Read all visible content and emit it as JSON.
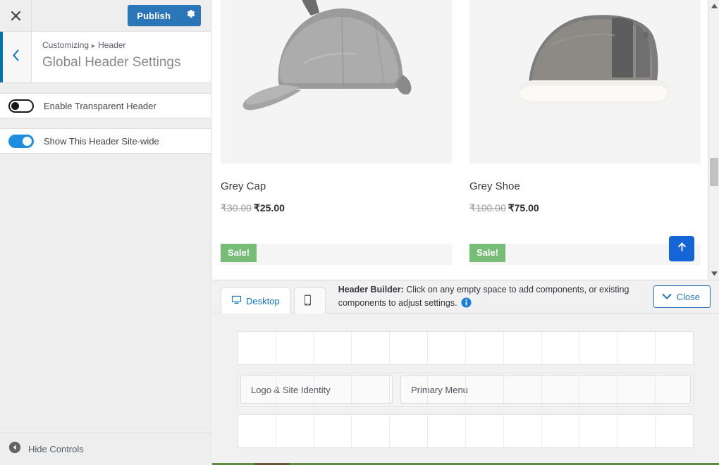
{
  "customizer": {
    "close_icon": "close-x-icon",
    "publish_label": "Publish",
    "gear_icon": "gear-icon",
    "back_icon": "chevron-left-icon",
    "breadcrumb": {
      "root": "Customizing",
      "separator": "▸",
      "current": "Header"
    },
    "panel_title": "Global Header Settings",
    "controls": [
      {
        "label": "Enable Transparent Header",
        "state": "off"
      },
      {
        "label": "Show This Header Site-wide",
        "state": "on"
      }
    ],
    "footer": {
      "label": "Hide Controls",
      "icon": "collapse-left-icon"
    },
    "accent_color": "#0073aa",
    "publish_color": "#2a76b8",
    "toggle_on_color": "#1f8ddd"
  },
  "preview": {
    "products": [
      {
        "name": "Grey Cap",
        "price_old": "₹30.00",
        "price_new": "₹25.00",
        "image_alt": "grey-cap-image",
        "sale_badge": "Sale!"
      },
      {
        "name": "Grey Shoe",
        "price_old": "₹100.00",
        "price_new": "₹75.00",
        "image_alt": "grey-shoe-image",
        "sale_badge": "Sale!"
      }
    ],
    "scroll_top_icon": "arrow-up-icon",
    "scroll_top_color": "#1565d8",
    "sale_badge_color": "#77bd78",
    "scrollbar": {
      "up_arrow_icon": "scroll-up-arrow-icon",
      "down_arrow_icon": "scroll-down-arrow-icon"
    }
  },
  "header_builder": {
    "tabs": [
      {
        "label": "Desktop",
        "icon": "desktop-icon",
        "active": true
      },
      {
        "label": "",
        "icon": "mobile-icon",
        "active": false
      }
    ],
    "message_strong": "Header Builder:",
    "message_rest": " Click on any empty space to add components, or existing components to adjust settings.",
    "info_icon": "info-icon",
    "close_label": "Close",
    "close_icon": "chevron-down-icon",
    "grid_columns": 12,
    "rows": [
      {
        "name": "top-row",
        "items": []
      },
      {
        "name": "main-row",
        "items": [
          {
            "label": "Logo & Site Identity",
            "slot": "logo"
          },
          {
            "label": "Primary Menu",
            "slot": "menu"
          }
        ]
      },
      {
        "name": "bottom-row",
        "items": []
      }
    ]
  }
}
